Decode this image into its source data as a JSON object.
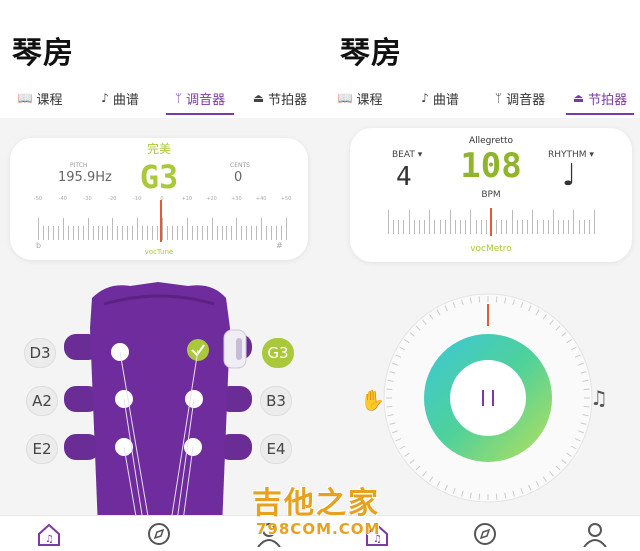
{
  "left": {
    "app_title": "琴房",
    "tabs": [
      {
        "label": "课程",
        "icon": "book-icon"
      },
      {
        "label": "曲谱",
        "icon": "music-note-icon"
      },
      {
        "label": "调音器",
        "icon": "tuning-fork-icon"
      },
      {
        "label": "节拍器",
        "icon": "metronome-icon"
      }
    ],
    "active_tab": "调音器",
    "tuner": {
      "status": "完美",
      "pitch_label": "PITCH",
      "pitch_value": "195.9Hz",
      "note": "G3",
      "cents_label": "CENTS",
      "cents_value": "0",
      "scale_labels": [
        "-50",
        "-40",
        "-30",
        "-20",
        "-10",
        "0",
        "+10",
        "+20",
        "+30",
        "+40",
        "+50"
      ],
      "flat_symbol": "b",
      "sharp_symbol": "#",
      "brand": "vocTune"
    },
    "strings_left": [
      "D3",
      "A2",
      "E2"
    ],
    "strings_right": [
      "G3",
      "B3",
      "E4"
    ],
    "selected_string": "G3",
    "colors": {
      "accent": "#7c3aa6",
      "perfect": "#a9c93a",
      "needle": "#e25a3a"
    }
  },
  "right": {
    "app_title": "琴房",
    "tabs": [
      {
        "label": "课程",
        "icon": "book-icon"
      },
      {
        "label": "曲谱",
        "icon": "music-note-icon"
      },
      {
        "label": "调音器",
        "icon": "tuning-fork-icon"
      },
      {
        "label": "节拍器",
        "icon": "metronome-icon"
      }
    ],
    "active_tab": "节拍器",
    "metronome": {
      "beat_label": "BEAT",
      "beat_value": "4",
      "tempo_name": "Allegretto",
      "bpm_value": "108",
      "bpm_label": "BPM",
      "rhythm_label": "RHYTHM",
      "rhythm_icon": "quarter-note-icon",
      "brand": "vocMetro",
      "play_state": "pause-icon"
    }
  },
  "watermark": {
    "text": "吉他之家",
    "sub": "798COM.COM"
  }
}
